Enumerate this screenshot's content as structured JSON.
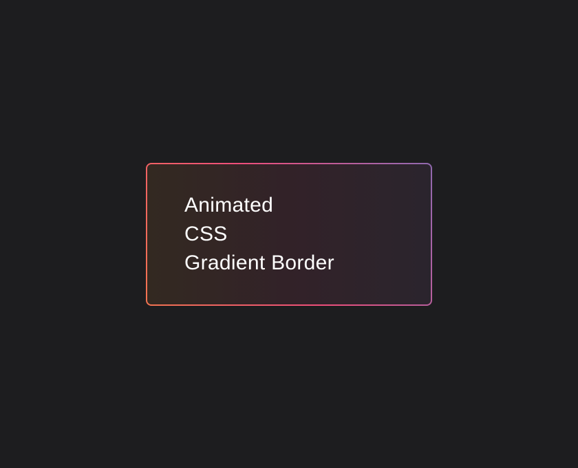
{
  "card": {
    "line1": "Animated",
    "line2": "CSS",
    "line3": "Gradient Border"
  },
  "colors": {
    "background": "#1d1d1f",
    "text": "#ffffff",
    "gradient": [
      "#f79533",
      "#f37055",
      "#ef4e7b",
      "#a166ab",
      "#5073b8",
      "#1098ad",
      "#07b39b",
      "#6fba82"
    ]
  }
}
